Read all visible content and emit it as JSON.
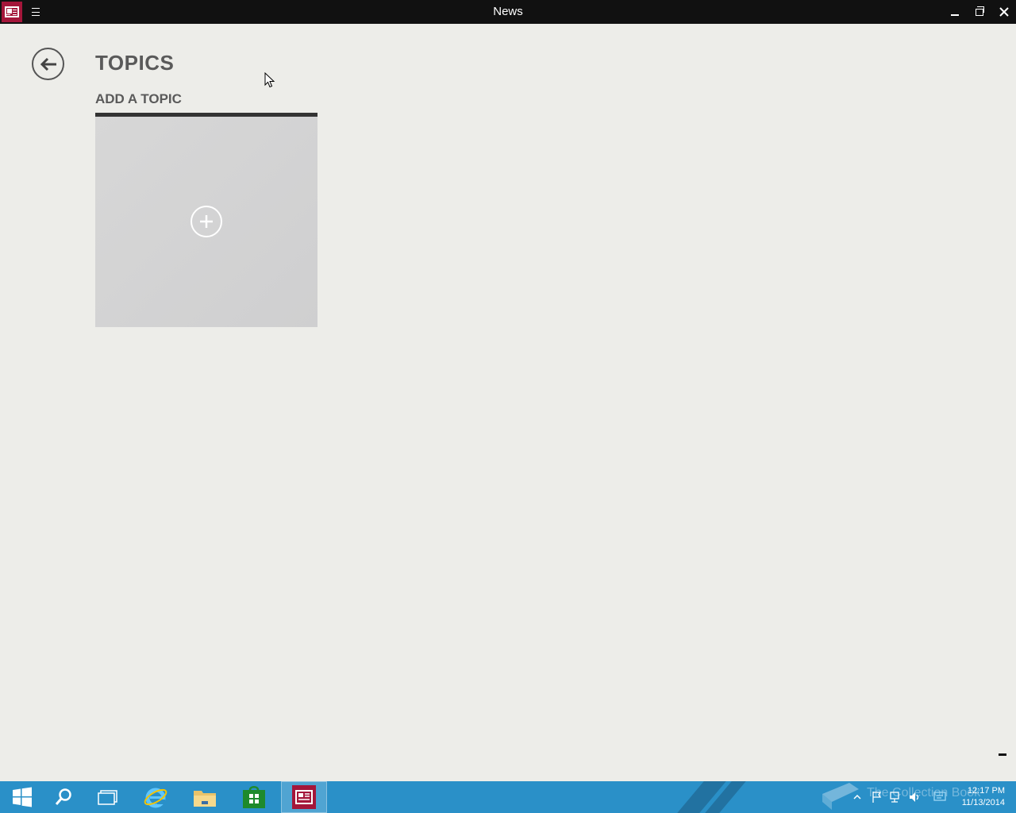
{
  "window": {
    "title": "News"
  },
  "page": {
    "title": "TOPICS",
    "section_title": "ADD A TOPIC"
  },
  "icons": {
    "app": "news-app-icon",
    "menu": "hamburger-icon",
    "back": "back-arrow-icon",
    "add": "plus-circle-icon",
    "zoom": "minus-icon"
  },
  "taskbar": {
    "items": [
      "start",
      "search",
      "task-view",
      "internet-explorer",
      "file-explorer",
      "store",
      "news"
    ],
    "active": "news",
    "watermark": "The Collection Book",
    "clock": {
      "time": "12:17 PM",
      "date": "11/13/2014"
    }
  },
  "colors": {
    "titlebar": "#111111",
    "accent": "#a4163a",
    "background": "#edede9",
    "taskbar": "#2a90c8"
  }
}
